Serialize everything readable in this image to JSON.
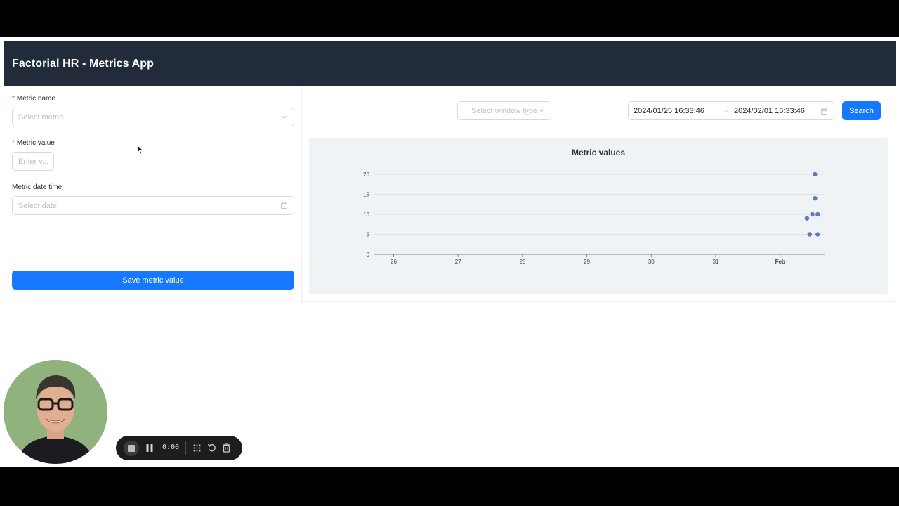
{
  "app": {
    "title": "Factorial HR - Metrics App"
  },
  "form": {
    "metric_name": {
      "label": "Metric name",
      "required_mark": "*",
      "placeholder": "Select metric"
    },
    "metric_value": {
      "label": "Metric value",
      "required_mark": "*",
      "placeholder": "Enter v..."
    },
    "metric_date": {
      "label": "Metric date time",
      "placeholder": "Select date"
    },
    "save_label": "Save metric value"
  },
  "filters": {
    "window_type_placeholder": "Select window type",
    "range_start": "2024/01/25 16:33:46",
    "range_arrow": "→",
    "range_end": "2024/02/01 16:33:46",
    "search_label": "Search"
  },
  "chart_data": {
    "type": "scatter",
    "title": "Metric values",
    "xlabel": "",
    "ylabel": "",
    "x_tick_labels": [
      "26",
      "27",
      "28",
      "29",
      "30",
      "31",
      "Feb"
    ],
    "x_tick_dates": [
      "2024-01-26",
      "2024-01-27",
      "2024-01-28",
      "2024-01-29",
      "2024-01-30",
      "2024-01-31",
      "2024-02-01"
    ],
    "xlim": [
      "2024-01-25 16:33",
      "2024-02-01 16:33"
    ],
    "y_ticks": [
      0,
      5,
      10,
      15,
      20
    ],
    "ylim": [
      0,
      20
    ],
    "grid": true,
    "point_color": "#5b7bc0",
    "points": [
      {
        "x": "2024-02-01 13:00",
        "y": 20
      },
      {
        "x": "2024-02-01 13:00",
        "y": 14
      },
      {
        "x": "2024-02-01 12:00",
        "y": 10
      },
      {
        "x": "2024-02-01 14:00",
        "y": 10
      },
      {
        "x": "2024-02-01 10:00",
        "y": 9
      },
      {
        "x": "2024-02-01 11:00",
        "y": 5
      },
      {
        "x": "2024-02-01 14:00",
        "y": 5
      }
    ]
  },
  "recorder": {
    "timer": "0:00"
  },
  "colors": {
    "header_bg": "#222b3a",
    "primary": "#1677ff",
    "chart_bg": "#f0f3f6",
    "required": "#ff4d4f"
  }
}
